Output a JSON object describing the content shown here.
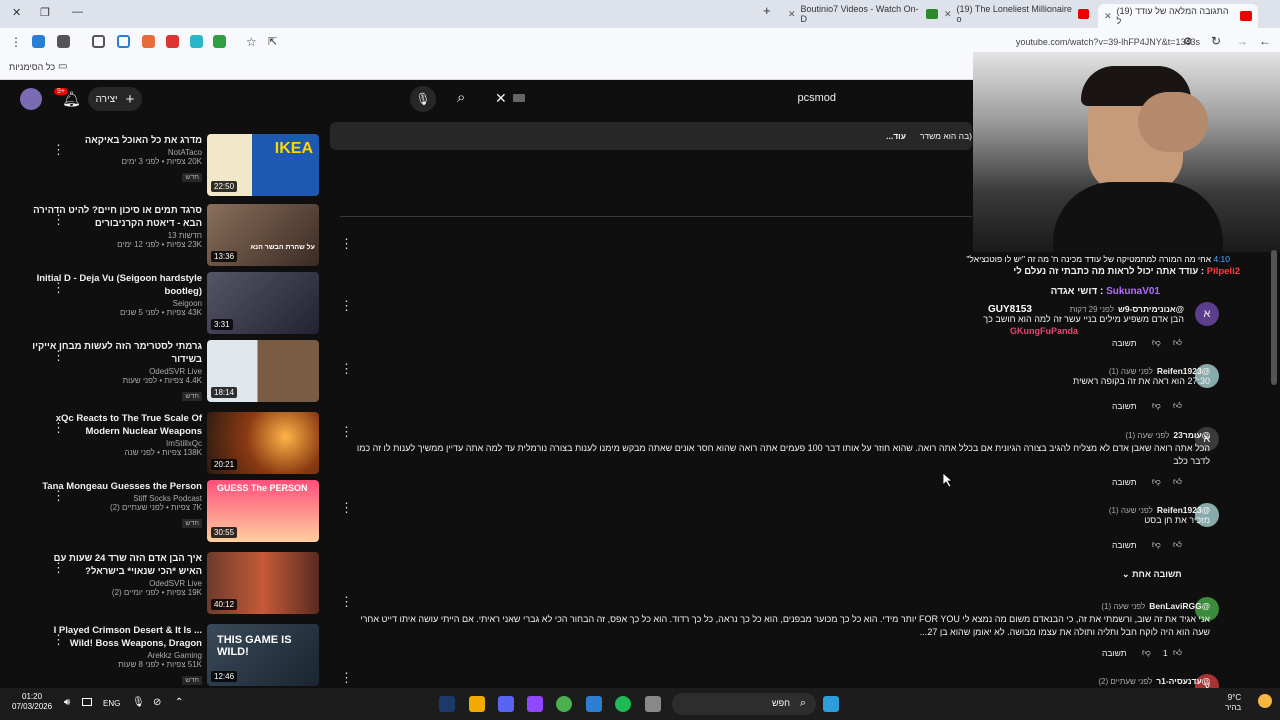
{
  "tabs": [
    {
      "title": "(19) התגובה המלאה של עודד ל",
      "active": true
    },
    {
      "title": "(19) The Loneliest Millionaire o"
    },
    {
      "title": "Boutinio7 Videos - Watch On-D"
    }
  ],
  "address_url": "youtube.com/watch?v=39-lhFP4JNY&t=1343s",
  "bookmarks_label": "כל הסימניות",
  "yt": {
    "search_value": "pcsmod",
    "create_label": "יצירה",
    "notif_count": "9+"
  },
  "top_snippet": {
    "text": "בה הוא משדר)",
    "more": "...עוד"
  },
  "videos": [
    {
      "title": "מדרג את כל האוכל באיקאה",
      "channel": "NotATaco",
      "meta": "20K צפיות • לפני 3 ימים",
      "badge": "חדש",
      "duration": "22:50",
      "thumb_text": "IKEA"
    },
    {
      "title": "סרגד תמים או סיכון חיים? להיט הדהירה הבא - דיאטת הקרניבורים",
      "channel": "חדשות 13",
      "meta": "23K צפיות • לפני 12 ימים",
      "badge": "",
      "duration": "13:36",
      "thumb_text": "על שהרת הבשר הנא"
    },
    {
      "title": "Initial D - Deja Vu (Seigoon hardstyle bootleg)",
      "channel": "Seigoon",
      "meta": "43K צפיות • לפני 5 שנים",
      "badge": "",
      "duration": "3:31",
      "thumb_text": ""
    },
    {
      "title": "גרמתי לסטרימר הזה לעשות מבחן אייקיו בשידור",
      "channel": "OdedSVR Live",
      "meta": "4.4K צפיות • לפני שעות",
      "badge": "חדש",
      "duration": "18:14",
      "thumb_text": ""
    },
    {
      "title": "xQc Reacts to The True Scale Of Modern Nuclear Weapons",
      "channel": "ImStillxQc",
      "meta": "138K צפיות • לפני שנה",
      "badge": "",
      "duration": "20:21",
      "thumb_text": ""
    },
    {
      "title": "Tana Mongeau Guesses the Person",
      "channel": "Stiff Socks Podcast",
      "meta": "7K צפיות • לפני שעתיים (2)",
      "badge": "חדש",
      "duration": "30:55",
      "thumb_text": "GUESS The PERSON"
    },
    {
      "title": "איך הבן אדם הזה שרד 24 שעות עם האיש *הכי שנאוי* בישראל?",
      "channel": "OdedSVR Live",
      "meta": "19K צפיות • לפני יומיים (2)",
      "badge": "",
      "duration": "40:12",
      "thumb_text": ""
    },
    {
      "title": "I Played Crimson Desert & It Is ... Wild! Boss Weapons, Dragon",
      "channel": "Arekkz Gaming",
      "meta": "51K צפיות • לפני 8 שעות",
      "badge": "חדש",
      "duration": "12:46",
      "thumb_text": "THIS GAME IS WILD!"
    }
  ],
  "chat": [
    {
      "time": "4:10",
      "text": "אחי מה המורה למתמטיקה של עודד מכינה ח' מה זה \"יש לו פוטנציאל\""
    },
    {
      "user": "Pilpeli2",
      "text": "עודד אתה יכול לראות מה כתבתי זה נעלם לי"
    },
    {
      "user": "SukunaV01",
      "text": "דושי אגדה"
    },
    {
      "user": "GUY8153",
      "text": ""
    },
    {
      "user": "GKungFuPanda",
      "text": ""
    }
  ],
  "comments": [
    {
      "author": "@אנונימיתרס-9ש",
      "time": "לפני 29 דקות",
      "text": "הבן אדם משפיע מילים בניי עשר זה למה הוא חושב כך",
      "reply": "תשובה",
      "avatar_letter": "א",
      "likes": ""
    },
    {
      "author": "@Reifen1923",
      "time": "לפני שעה (1)",
      "text": "27:30 הוא ראה את זה בקופה ראשית",
      "reply": "תשובה",
      "avatar_letter": "",
      "likes": ""
    },
    {
      "author": "@עומר23",
      "time": "לפני שעה (1)",
      "text": "הכל אתה רואה שאבן אדם לא מצליח להגיב בצורה הגיונית אם בכלל אתה רואה. שהוא חוזר על אותו דבר 100 פעמים אתה רואה שהוא חסר אונים שאתה מבקש מימנו לענות בצורה נורמלית עד למה אתה עדיין ממשיך לענות לו זה כמו לדבר כלב",
      "reply": "תשובה",
      "avatar_letter": "א",
      "likes": ""
    },
    {
      "author": "@Reifen1923",
      "time": "לפני שעה (1)",
      "text": "מזכיר את חן בסט",
      "reply": "תשובה",
      "avatar_letter": "",
      "likes": ""
    },
    {
      "author": "@BenLaviRGG",
      "time": "לפני שעה (1)",
      "text": "אני אגיד את זה שוב, ורשמתי את זה, כי הבנאדם משום מה נמצא לי FOR YOU יותר מידי. הוא כל כך מכוער מבפנים, הוא כל כך נראה, כל כך רדוד. הוא כל כך אפס, זה הבחור הכי לא גברי שאני ראיתי. אם הייתי עושה איתו דייט אחרי שעה הוא היה לוקח חבל ותליה ותולה את עצמו מבושה. לא יאומן שהוא בן 27...",
      "reply": "תשובה",
      "avatar_letter": "",
      "likes": "1"
    },
    {
      "author": "@עדנעסיה-1ר",
      "time": "לפני שעתיים (2)",
      "text": "",
      "reply": "",
      "avatar_letter": "ע",
      "likes": ""
    }
  ],
  "replies_toggle": "תשובה אחת",
  "taskbar": {
    "time": "01:20",
    "date": "07/03/2026",
    "lang": "ENG",
    "search": "חפש",
    "weather_temp": "9°C",
    "weather_text": "בהיר"
  }
}
